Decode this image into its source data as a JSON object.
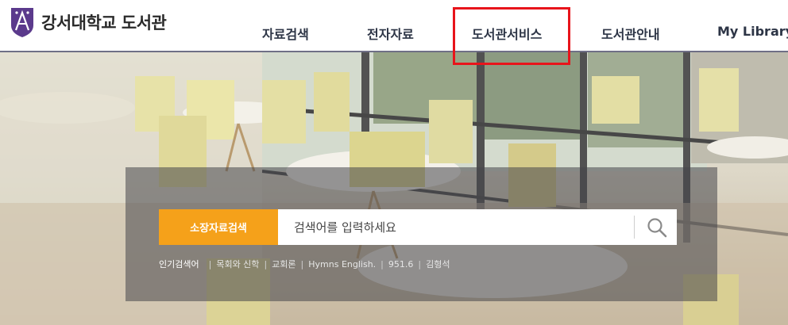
{
  "header": {
    "library_name": "강서대학교 도서관",
    "nav": [
      {
        "label": "자료검색"
      },
      {
        "label": "전자자료"
      },
      {
        "label": "도서관서비스"
      },
      {
        "label": "도서관안내"
      },
      {
        "label": "My Library"
      }
    ]
  },
  "highlight": {
    "color": "#e8141b",
    "target": "도서관서비스"
  },
  "search": {
    "tab_label": "소장자료검색",
    "placeholder": "검색어를 입력하세요",
    "value": "",
    "button_icon": "search-icon"
  },
  "popular": {
    "label": "인기검색어",
    "keywords": [
      "목회와 신학",
      "교회론",
      "Hymns English.",
      "951.6",
      "김형석"
    ]
  },
  "colors": {
    "accent": "#f5a11a",
    "brand": "#5b3a8c",
    "nav_text": "#2d3546"
  }
}
